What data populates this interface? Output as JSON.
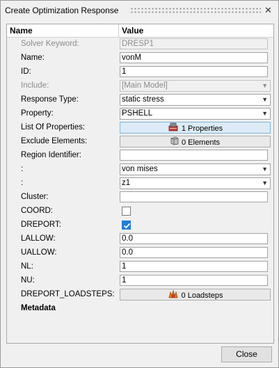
{
  "window": {
    "title": "Create Optimization Response",
    "close_glyph": "✕"
  },
  "table": {
    "col_name": "Name",
    "col_value": "Value"
  },
  "rows": {
    "solver_keyword": {
      "label": "Solver Keyword:",
      "value": "DRESP1"
    },
    "name": {
      "label": "Name:",
      "value": "vonM"
    },
    "id": {
      "label": "ID:",
      "value": "1"
    },
    "include": {
      "label": "Include:",
      "value": "[Main Model]"
    },
    "response_type": {
      "label": "Response Type:",
      "value": "static stress"
    },
    "property": {
      "label": "Property:",
      "value": "PSHELL"
    },
    "list_of_properties": {
      "label": "List Of Properties:",
      "value": "1 Properties",
      "icon": "properties-icon"
    },
    "exclude_elements": {
      "label": "Exclude Elements:",
      "value": "0 Elements",
      "icon": "elements-icon"
    },
    "region_identifier": {
      "label": "Region Identifier:",
      "value": ""
    },
    "colon1": {
      "label": ":",
      "value": "von mises"
    },
    "colon2": {
      "label": ":",
      "value": "z1"
    },
    "cluster": {
      "label": "Cluster:",
      "value": ""
    },
    "coord": {
      "label": "COORD:",
      "checked": false
    },
    "dreport": {
      "label": "DREPORT:",
      "checked": true
    },
    "lallow": {
      "label": "LALLOW:",
      "value": "0.0"
    },
    "uallow": {
      "label": "UALLOW:",
      "value": "0.0"
    },
    "nl": {
      "label": "NL:",
      "value": "1"
    },
    "nu": {
      "label": "NU:",
      "value": "1"
    },
    "dreport_loadsteps": {
      "label": "DREPORT_LOADSTEPS:",
      "value": "0 Loadsteps",
      "icon": "loadsteps-icon"
    },
    "metadata": {
      "label": "Metadata"
    }
  },
  "footer": {
    "close_label": "Close"
  },
  "colors": {
    "accent": "#1e7fd6",
    "active_button": "#dcebf7"
  }
}
